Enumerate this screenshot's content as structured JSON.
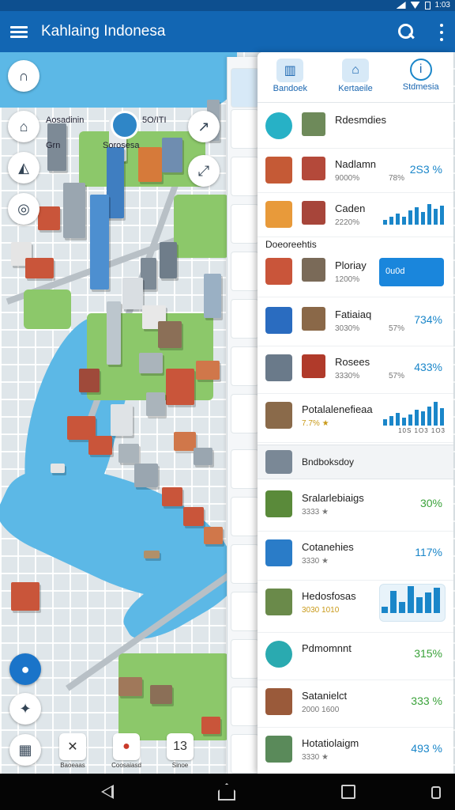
{
  "status": {
    "time": "1:03"
  },
  "appbar": {
    "title": "Kahlaing Indonesa"
  },
  "map": {
    "info": {
      "label_a": "Aosadinin",
      "label_b": "Grn",
      "label_c": "5O/ITI",
      "label_d": "Sorosesa"
    },
    "bottom_tools": [
      {
        "icon": "tools-icon",
        "label": "Baoeaas"
      },
      {
        "icon": "alert-icon",
        "label": "Coosaiasd"
      },
      {
        "icon": "number-icon",
        "label": "Sinoe"
      }
    ]
  },
  "panel": {
    "tabs": [
      {
        "icon": "city-icon",
        "label": "Bandoek"
      },
      {
        "icon": "building-icon",
        "label": "Kertaeile"
      },
      {
        "icon": "info-icon",
        "label": "Stdmesia"
      }
    ],
    "rows_top": [
      {
        "name": "Rdesmdies",
        "sub": "",
        "value": ""
      },
      {
        "name": "Nadlamn",
        "sub": "9000%",
        "sub2": "78%",
        "value": "2S3 %"
      },
      {
        "name": "Caden",
        "sub": "2220%",
        "value": ""
      }
    ],
    "section1": "Doeoreehtis",
    "rows_mid": [
      {
        "name": "Ploriay",
        "sub": "1200%",
        "pill": "0u0d"
      },
      {
        "name": "Fatiaiaq",
        "sub": "3030%",
        "sub2": "57%",
        "value": "734%"
      },
      {
        "name": "Rosees",
        "sub": "3330%",
        "sub2": "57%",
        "value": "433%"
      },
      {
        "name": "Potalalenefieaa",
        "sub": "7.7% ★",
        "axis": "10S 1O3 1O3"
      }
    ],
    "section2": "Bndboksdoy",
    "rows_bottom": [
      {
        "name": "Sralarlebiaigs",
        "sub": "3333 ★",
        "value": "30%"
      },
      {
        "name": "Cotanehies",
        "sub": "3330 ★",
        "value": "117%"
      },
      {
        "name": "Hedosfosas",
        "sub": "3030 1010",
        "value": ""
      },
      {
        "name": "Pdmomnnt",
        "sub": "",
        "value": "315%"
      },
      {
        "name": "Satanielct",
        "sub": "2000 1600",
        "value": "333 %"
      },
      {
        "name": "Hotatiolaigm",
        "sub": "3330 ★",
        "value": "493 %"
      }
    ]
  }
}
